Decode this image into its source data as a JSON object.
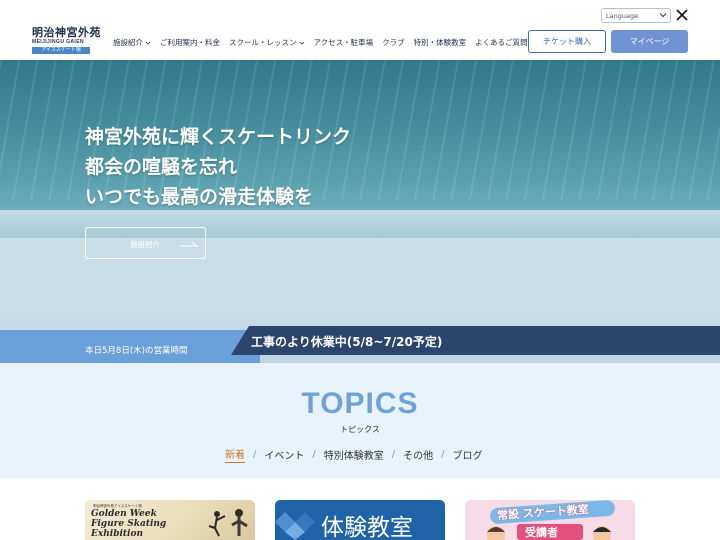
{
  "header": {
    "logo_main": "明治神宮外苑",
    "logo_sub": "MEIJIJINGU GAIEN",
    "logo_tag": "アイススケート場",
    "language_label": "Language",
    "nav": [
      {
        "label": "施設紹介",
        "has_dropdown": true
      },
      {
        "label": "ご利用案内・料金",
        "has_dropdown": false
      },
      {
        "label": "スクール・レッスン",
        "has_dropdown": true
      },
      {
        "label": "アクセス・駐車場",
        "has_dropdown": false
      },
      {
        "label": "クラブ",
        "has_dropdown": false
      },
      {
        "label": "特別・体験教室",
        "has_dropdown": false
      },
      {
        "label": "よくあるご質問",
        "has_dropdown": false
      }
    ],
    "ticket_button": "チケット購入",
    "mypage_button": "マイページ"
  },
  "hero": {
    "title_lines": [
      "神宮外苑に輝くスケートリンク",
      "都会の喧騒を忘れ",
      "いつでも最高の滑走体験を"
    ],
    "button_label": "施設紹介"
  },
  "status": {
    "date_text": "本日5月8日(木)の営業時間",
    "notice": "工事のより休業中(5/8~7/20予定)"
  },
  "topics": {
    "title": "TOPICS",
    "subtitle": "トピックス",
    "tabs": [
      "新着",
      "イベント",
      "特別体験教室",
      "その他",
      "ブログ"
    ],
    "active_tab": 0,
    "separator": "/"
  },
  "cards": {
    "card1": {
      "small_text": "明治神宮外苑アイススケート場",
      "lines": [
        "Golden Week",
        "Figure Skating",
        "Exhibition"
      ]
    },
    "card2": {
      "text": "体験教室"
    },
    "card3": {
      "line1": "常設 スケート教室",
      "line2": "受講者"
    }
  },
  "colors": {
    "navy": "#1f2d4d",
    "accent_blue": "#3f6bb5",
    "mypage_blue": "#6f93d3",
    "status_light": "#6b9fdc",
    "status_dark": "#2b456c",
    "topics_bg": "#e9f3fb",
    "topics_title": "#6fa2d9",
    "tab_active": "#c97b2a"
  }
}
